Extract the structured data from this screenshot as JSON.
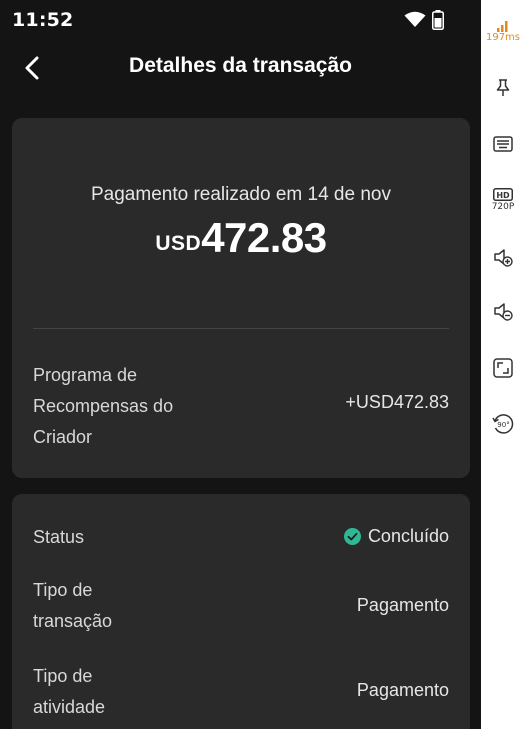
{
  "status_bar": {
    "time": "11:52",
    "wifi_icon": "wifi-icon",
    "battery_icon": "battery-icon"
  },
  "header": {
    "title": "Detalhes da transação",
    "back_icon": "chevron-left-icon"
  },
  "summary": {
    "paid_line": "Pagamento realizado em 14 de nov",
    "currency": "USD",
    "amount": "472.83",
    "program_label": "Programa de Recompensas do Criador",
    "program_value": "+USD472.83"
  },
  "details": {
    "rows": [
      {
        "label": "Status",
        "value": "Concluído",
        "icon": "check-circle-icon"
      },
      {
        "label": "Tipo de transação",
        "value": "Pagamento"
      },
      {
        "label": "Tipo de atividade",
        "value": "Pagamento"
      }
    ]
  },
  "emulator_toolbar": {
    "ping": "197ms",
    "hd_label": "HD",
    "resolution": "720P",
    "items": [
      "signal-icon",
      "pin-icon",
      "keyboard-icon",
      "hd-icon",
      "volume-up-icon",
      "volume-down-icon",
      "fullscreen-icon",
      "rotate-icon"
    ],
    "rotate_label": "90°"
  },
  "colors": {
    "background": "#141414",
    "card": "#2a2a2a",
    "success": "#2fb894",
    "ping": "#e08a1e"
  }
}
